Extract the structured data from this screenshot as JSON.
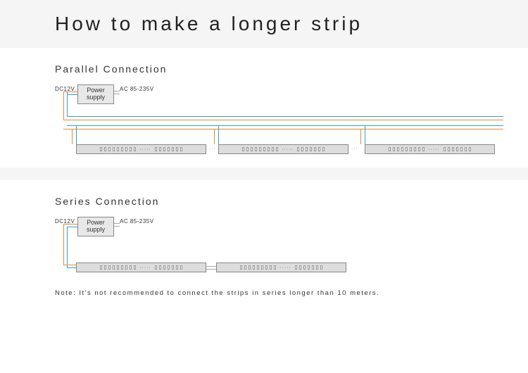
{
  "title": "How to make a longer strip",
  "parallel": {
    "heading": "Parallel Connection",
    "dc_label": "DC12V",
    "ac_label": "AC 85-235V",
    "psu_label": "Power supply"
  },
  "series": {
    "heading": "Series Connection",
    "dc_label": "DC12V",
    "ac_label": "AC 85-235V",
    "psu_label": "Power supply",
    "note": "Note: It's not recommended to connect the strips in series longer than 10 meters."
  }
}
